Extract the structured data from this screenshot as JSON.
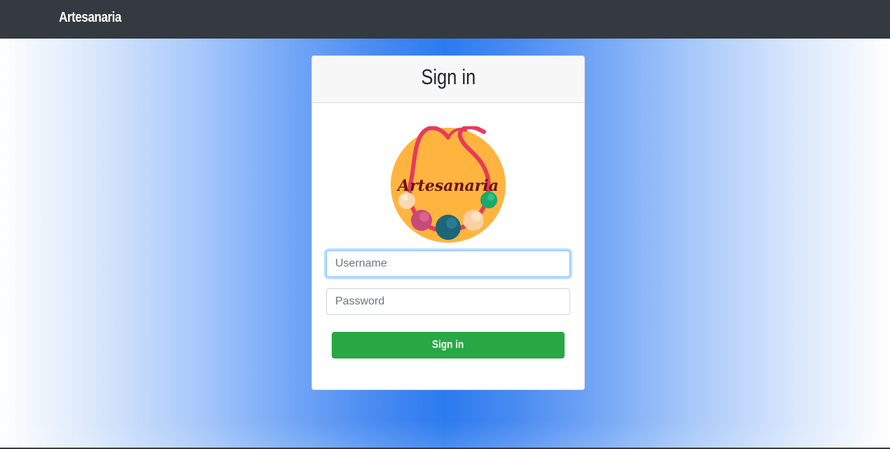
{
  "navbar": {
    "brand": "Artesanaria"
  },
  "login": {
    "title": "Sign in",
    "logo_text": "Artesanaria",
    "username_placeholder": "Username",
    "password_placeholder": "Password",
    "submit_label": "Sign in"
  },
  "colors": {
    "navbar_bg": "#343a40",
    "accent_blue": "#2b7bf0",
    "button_green": "#28a745",
    "logo_circle": "#ffb43f",
    "logo_cord": "#e83a5a",
    "logo_text": "#6b1212"
  },
  "icons": [
    "artesanaria-logo"
  ]
}
